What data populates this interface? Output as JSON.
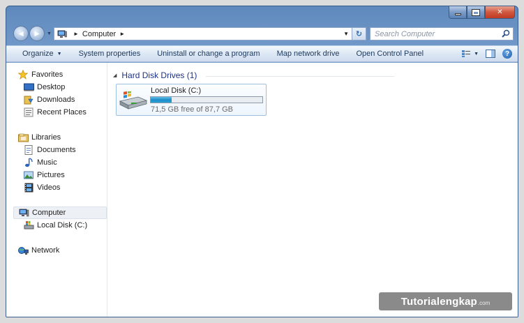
{
  "window": {
    "minimize": "–",
    "maximize": "□",
    "close": "✕"
  },
  "navbar": {
    "back_icon": "back-arrow-icon",
    "forward_icon": "forward-arrow-icon",
    "breadcrumb": [
      "Computer"
    ],
    "search_placeholder": "Search Computer"
  },
  "commands": [
    {
      "label": "Organize",
      "dropdown": true
    },
    {
      "label": "System properties"
    },
    {
      "label": "Uninstall or change a program"
    },
    {
      "label": "Map network drive"
    },
    {
      "label": "Open Control Panel"
    }
  ],
  "sidebar": {
    "favorites": {
      "label": "Favorites",
      "items": [
        "Desktop",
        "Downloads",
        "Recent Places"
      ]
    },
    "libraries": {
      "label": "Libraries",
      "items": [
        "Documents",
        "Music",
        "Pictures",
        "Videos"
      ]
    },
    "computer": {
      "label": "Computer",
      "items": [
        "Local Disk (C:)"
      ]
    },
    "network": {
      "label": "Network"
    }
  },
  "main": {
    "group_title": "Hard Disk Drives (1)",
    "drive": {
      "name": "Local Disk (C:)",
      "free_text": "71,5 GB free of 87,7 GB",
      "used_fraction": 0.185
    }
  },
  "watermark": {
    "brand": "Tutorialengkap",
    "suffix": ".com"
  },
  "colors": {
    "accent": "#1e3287",
    "progress": "#2a9fd6"
  }
}
